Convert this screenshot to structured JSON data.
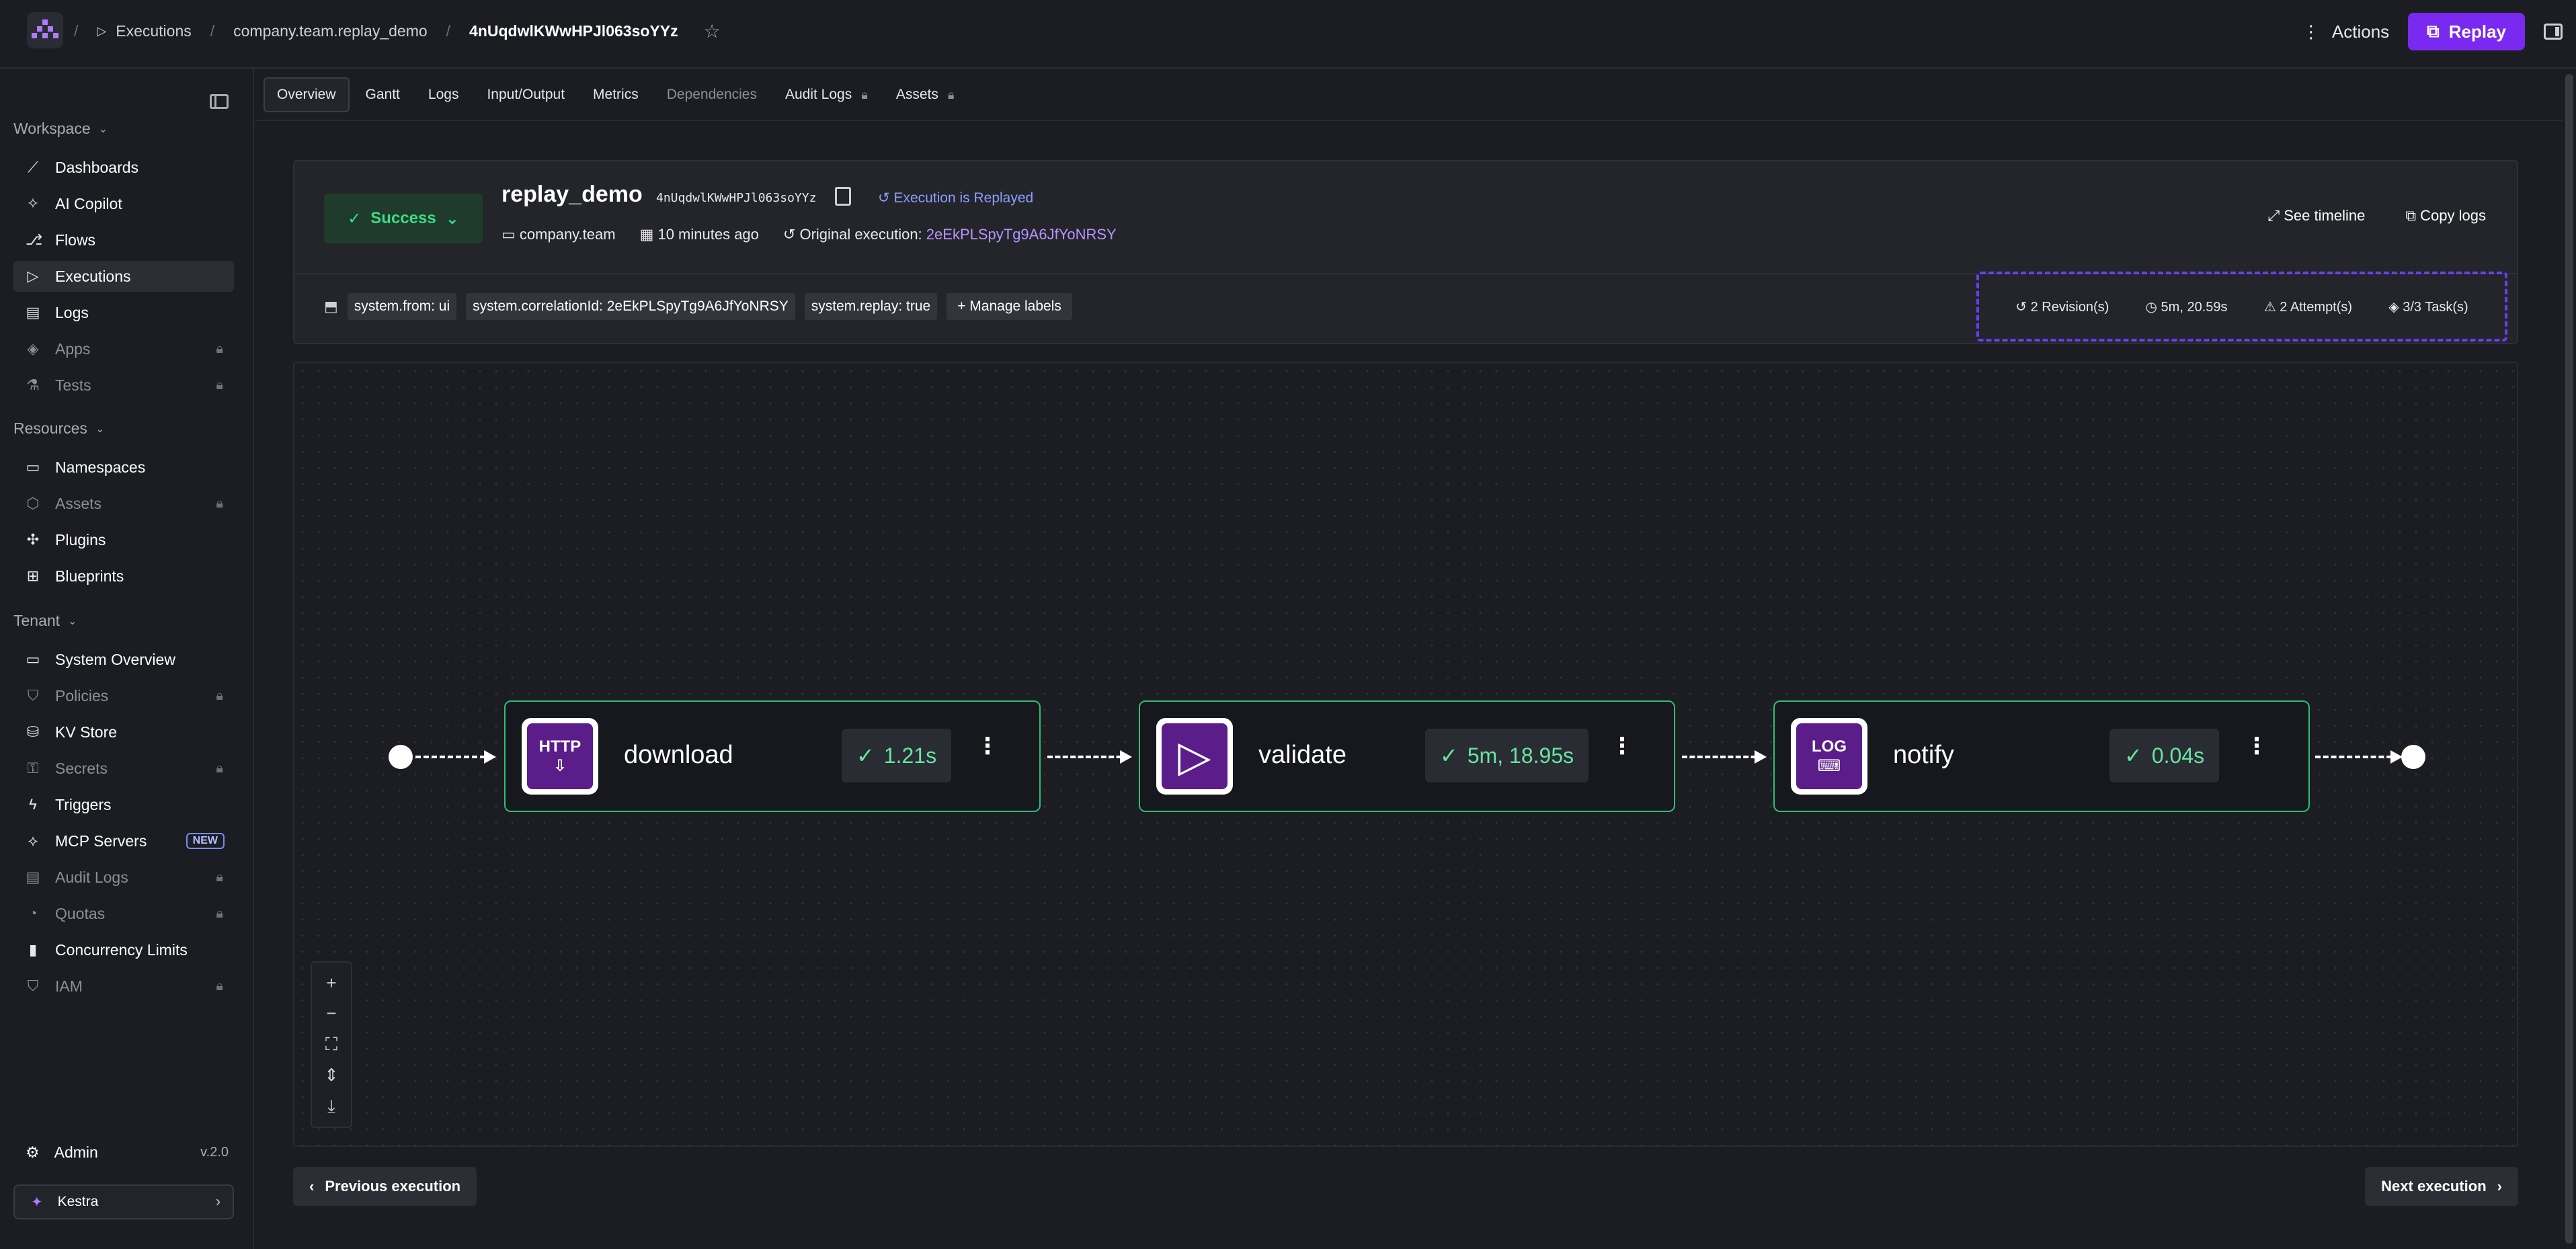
{
  "header": {
    "breadcrumbs": [
      "Executions",
      "company.team.replay_demo",
      "4nUqdwlKWwHPJl063soYYz"
    ],
    "actions_label": "Actions",
    "replay_label": "Replay"
  },
  "sidebar": {
    "sections": [
      {
        "label": "Workspace",
        "items": [
          {
            "label": "Dashboards",
            "icon": "chart-line-icon",
            "locked": false,
            "active": false
          },
          {
            "label": "AI Copilot",
            "icon": "sparkles-icon",
            "locked": false,
            "active": false
          },
          {
            "label": "Flows",
            "icon": "flow-icon",
            "locked": false,
            "active": false
          },
          {
            "label": "Executions",
            "icon": "play-icon",
            "locked": false,
            "active": true
          },
          {
            "label": "Logs",
            "icon": "document-icon",
            "locked": false,
            "active": false
          },
          {
            "label": "Apps",
            "icon": "layers-icon",
            "locked": true,
            "active": false
          },
          {
            "label": "Tests",
            "icon": "flask-icon",
            "locked": true,
            "active": false
          }
        ]
      },
      {
        "label": "Resources",
        "items": [
          {
            "label": "Namespaces",
            "icon": "folder-icon",
            "locked": false,
            "active": false
          },
          {
            "label": "Assets",
            "icon": "cube-icon",
            "locked": true,
            "active": false
          },
          {
            "label": "Plugins",
            "icon": "puzzle-icon",
            "locked": false,
            "active": false
          },
          {
            "label": "Blueprints",
            "icon": "blueprint-icon",
            "locked": false,
            "active": false
          }
        ]
      },
      {
        "label": "Tenant",
        "items": [
          {
            "label": "System Overview",
            "icon": "monitor-icon",
            "locked": false,
            "active": false
          },
          {
            "label": "Policies",
            "icon": "shield-icon",
            "locked": true,
            "active": false
          },
          {
            "label": "KV Store",
            "icon": "database-icon",
            "locked": false,
            "active": false
          },
          {
            "label": "Secrets",
            "icon": "key-icon",
            "locked": true,
            "active": false
          },
          {
            "label": "Triggers",
            "icon": "bolt-icon",
            "locked": false,
            "active": false
          },
          {
            "label": "MCP Servers",
            "icon": "mcp-icon",
            "locked": false,
            "active": false,
            "badge": "NEW"
          },
          {
            "label": "Audit Logs",
            "icon": "audit-icon",
            "locked": true,
            "active": false
          },
          {
            "label": "Quotas",
            "icon": "gauge-icon",
            "locked": true,
            "active": false
          },
          {
            "label": "Concurrency Limits",
            "icon": "lock-icon",
            "locked": false,
            "active": false
          },
          {
            "label": "IAM",
            "icon": "user-shield-icon",
            "locked": true,
            "active": false
          }
        ]
      }
    ],
    "admin_label": "Admin",
    "version": "v.2.0",
    "tenant_name": "Kestra"
  },
  "tabs": [
    {
      "label": "Overview",
      "active": true,
      "disabled": false,
      "locked": false
    },
    {
      "label": "Gantt",
      "active": false,
      "disabled": false,
      "locked": false
    },
    {
      "label": "Logs",
      "active": false,
      "disabled": false,
      "locked": false
    },
    {
      "label": "Input/Output",
      "active": false,
      "disabled": false,
      "locked": false
    },
    {
      "label": "Metrics",
      "active": false,
      "disabled": false,
      "locked": false
    },
    {
      "label": "Dependencies",
      "active": false,
      "disabled": true,
      "locked": false
    },
    {
      "label": "Audit Logs",
      "active": false,
      "disabled": false,
      "locked": true
    },
    {
      "label": "Assets",
      "active": false,
      "disabled": false,
      "locked": true
    }
  ],
  "execution": {
    "status": "Success",
    "flow_id": "replay_demo",
    "execution_id": "4nUqdwlKWwHPJl063soYYz",
    "replayed_label": "Execution is Replayed",
    "namespace": "company.team",
    "time_ago": "10 minutes ago",
    "original_label": "Original execution:",
    "original_id": "2eEkPLSpyTg9A6JfYoNRSY",
    "see_timeline_label": "See timeline",
    "copy_logs_label": "Copy logs",
    "labels": [
      "system.from: ui",
      "system.correlationId: 2eEkPLSpyTg9A6JfYoNRSY",
      "system.replay: true"
    ],
    "manage_labels_label": "Manage labels",
    "stats": {
      "revisions": "2 Revision(s)",
      "duration": "5m, 20.59s",
      "attempts": "2 Attempt(s)",
      "tasks": "3/3 Task(s)"
    }
  },
  "graph": {
    "tasks": [
      {
        "name": "download",
        "icon_text": "HTTP",
        "duration": "1.21s"
      },
      {
        "name": "validate",
        "icon_text": "",
        "duration": "5m, 18.95s"
      },
      {
        "name": "notify",
        "icon_text": "LOG",
        "duration": "0.04s"
      }
    ]
  },
  "footer": {
    "previous_label": "Previous execution",
    "next_label": "Next execution"
  },
  "colors": {
    "accent": "#7a29f0",
    "success": "#3ddc84",
    "link": "#b695ff",
    "stats_border": "#6a3ef0"
  }
}
